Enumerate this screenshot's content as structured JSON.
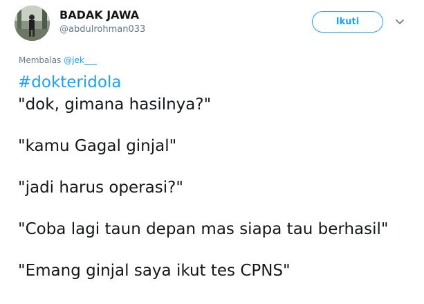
{
  "header": {
    "display_name": "BADAK JAWA",
    "username": "@abdulrohman033",
    "follow_label": "Ikuti"
  },
  "reply": {
    "prefix": "Membalas",
    "mention": "@jek___"
  },
  "tweet": {
    "hashtag": "#dokteridola",
    "lines": [
      "\"dok, gimana hasilnya?\"",
      "\"kamu Gagal ginjal\"",
      "\"jadi harus operasi?\"",
      "\"Coba lagi taun depan mas siapa tau berhasil\"",
      "\"Emang ginjal saya ikut tes CPNS\""
    ]
  },
  "icons": {
    "avatar": "profile-photo",
    "chevron": "chevron-down-icon"
  },
  "colors": {
    "accent": "#1da1f2",
    "text": "#14171a",
    "muted": "#657786"
  }
}
